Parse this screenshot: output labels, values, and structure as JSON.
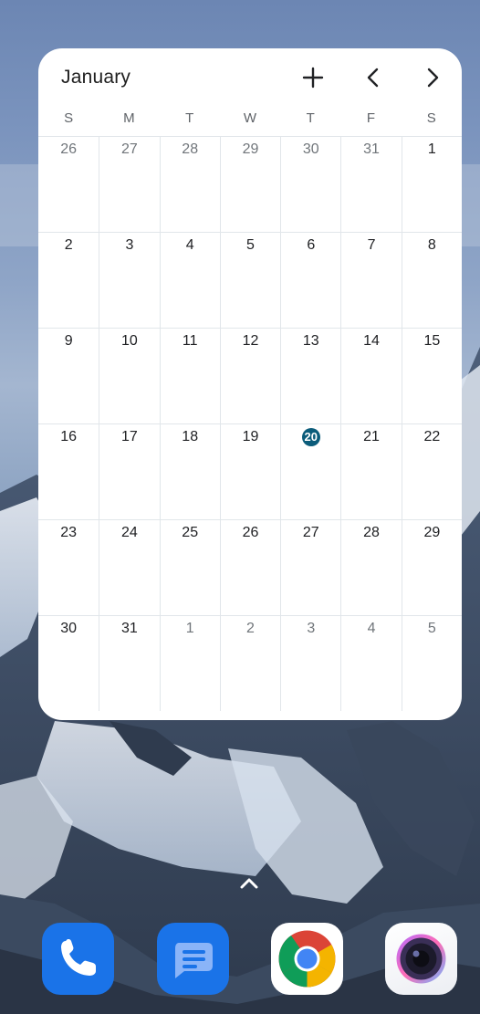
{
  "calendar": {
    "month_label": "January",
    "weekdays": [
      "S",
      "M",
      "T",
      "W",
      "T",
      "F",
      "S"
    ],
    "today": "20",
    "weeks": [
      [
        "26",
        "27",
        "28",
        "29",
        "30",
        "31",
        "1"
      ],
      [
        "2",
        "3",
        "4",
        "5",
        "6",
        "7",
        "8"
      ],
      [
        "9",
        "10",
        "11",
        "12",
        "13",
        "14",
        "15"
      ],
      [
        "16",
        "17",
        "18",
        "19",
        "20",
        "21",
        "22"
      ],
      [
        "23",
        "24",
        "25",
        "26",
        "27",
        "28",
        "29"
      ],
      [
        "30",
        "31",
        "1",
        "2",
        "3",
        "4",
        "5"
      ]
    ],
    "icons": {
      "add": "plus-icon",
      "previous": "chevron-left-icon",
      "next": "chevron-right-icon"
    }
  },
  "dock": {
    "apps": [
      {
        "name": "Phone",
        "icon": "phone-icon"
      },
      {
        "name": "Messages",
        "icon": "messages-icon"
      },
      {
        "name": "Chrome",
        "icon": "chrome-icon"
      },
      {
        "name": "Camera",
        "icon": "camera-icon"
      }
    ]
  },
  "drawer_icon": "chevron-up-icon",
  "colors": {
    "today_circle": "#0b5c7a",
    "widget_bg": "#ffffff",
    "dock_blue": "#1a73e8"
  }
}
